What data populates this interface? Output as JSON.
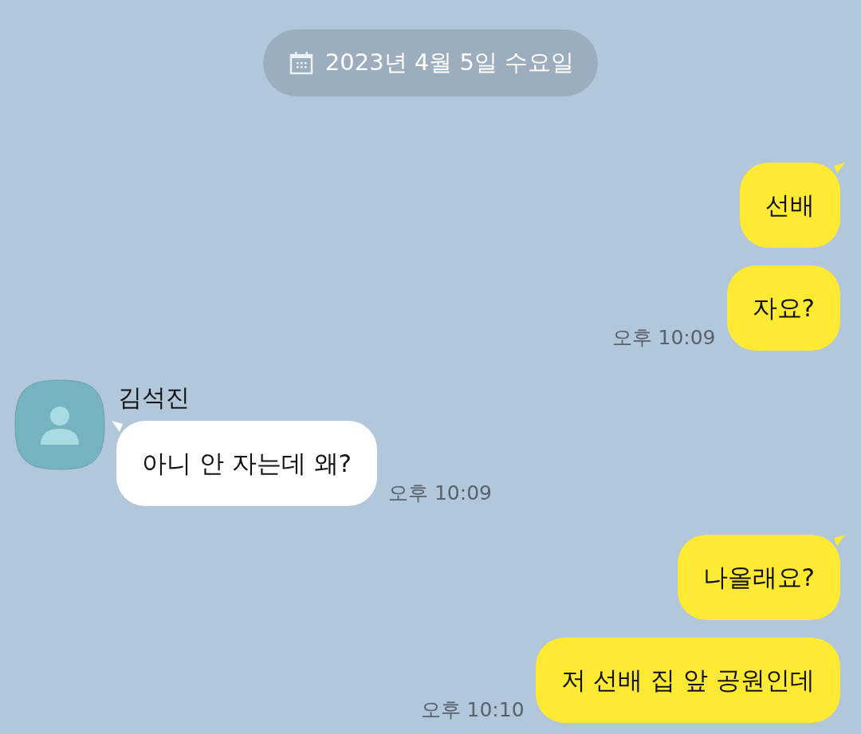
{
  "date_divider": {
    "text": "2023년 4월 5일 수요일"
  },
  "groups": [
    {
      "kind": "sent",
      "messages": [
        "선배",
        "자요?"
      ],
      "time": "오후 10:09"
    },
    {
      "kind": "received",
      "sender": "김석진",
      "messages": [
        "아니 안 자는데 왜?"
      ],
      "time": "오후 10:09"
    },
    {
      "kind": "sent",
      "messages": [
        "나올래요?",
        "저 선배 집 앞 공원인데"
      ],
      "time": "오후 10:10"
    }
  ]
}
